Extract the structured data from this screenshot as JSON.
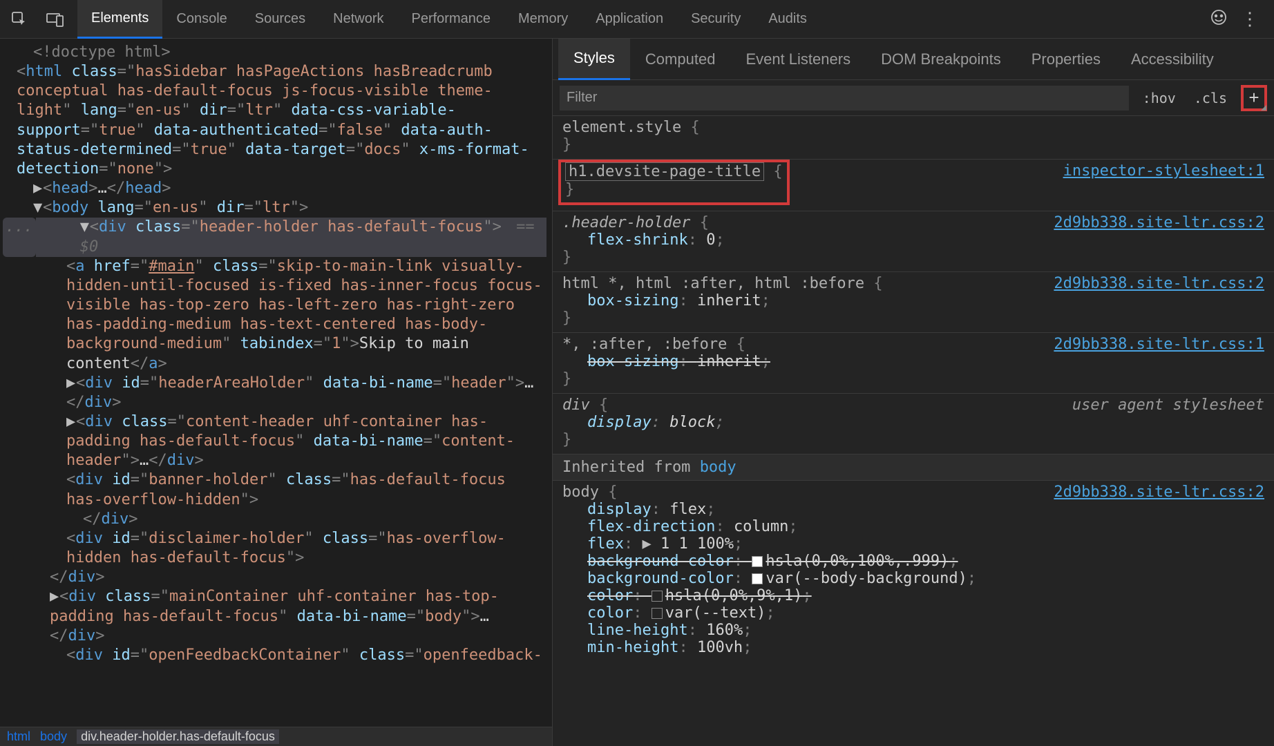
{
  "mainTabs": [
    "Elements",
    "Console",
    "Sources",
    "Network",
    "Performance",
    "Memory",
    "Application",
    "Security",
    "Audits"
  ],
  "mainActive": 0,
  "sidebarTabs": [
    "Styles",
    "Computed",
    "Event Listeners",
    "DOM Breakpoints",
    "Properties",
    "Accessibility"
  ],
  "sidebarActive": 0,
  "filter": {
    "placeholder": "Filter",
    "hov": ":hov",
    "cls": ".cls",
    "plus": "+"
  },
  "breadcrumbEllipsis": "...",
  "breadcrumb": [
    "html",
    "body",
    "div.header-holder.has-default-focus"
  ],
  "dom": {
    "doctype": "<!doctype html>",
    "htmlOpen": {
      "cls": "hasSidebar hasPageActions hasBreadcrumb conceptual has-default-focus js-focus-visible theme-light",
      "lang": "en-us",
      "dir": "ltr",
      "a1": "data-css-variable-support",
      "v1": "true",
      "a2": "data-authenticated",
      "v2": "false",
      "a3": "data-auth-status-determined",
      "v3": "true",
      "a4": "data-target",
      "v4": "docs",
      "a5": "x-ms-format-detection",
      "v5": "none"
    },
    "headCollapsed": "<head>…</head>",
    "bodyOpen": {
      "lang": "en-us",
      "dir": "ltr"
    },
    "headerHolder": {
      "cls": "header-holder has-default-focus",
      "eq": "== $0"
    },
    "skipLink": {
      "href": "#main",
      "cls": "skip-to-main-link visually-hidden-until-focused is-fixed has-inner-focus focus-visible has-top-zero has-left-zero has-right-zero has-padding-medium has-text-centered has-body-background-medium",
      "tabindex": "1",
      "text": "Skip to main content"
    },
    "headerArea": {
      "id": "headerAreaHolder",
      "bi": "header"
    },
    "contentHeader": {
      "cls": "content-header uhf-container has-padding has-default-focus",
      "bi": "content-header"
    },
    "bannerHolder": {
      "id": "banner-holder",
      "cls": "has-default-focus has-overflow-hidden"
    },
    "disclaimerHolder": {
      "id": "disclaimer-holder",
      "cls": "has-overflow-hidden has-default-focus"
    },
    "mainContainer": {
      "cls": "mainContainer  uhf-container has-top-padding  has-default-focus",
      "bi": "body"
    },
    "feedback": {
      "id": "openFeedbackContainer",
      "cls": "openfeedback-"
    }
  },
  "styles": {
    "r0": {
      "sel": "element.style"
    },
    "r1": {
      "sel": "h1.devsite-page-title",
      "src": "inspector-stylesheet:1"
    },
    "r2": {
      "sel": ".header-holder",
      "src": "2d9bb338.site-ltr.css:2",
      "p1n": "flex-shrink",
      "p1v": "0"
    },
    "r3": {
      "sel": "html *, html :after, html :before",
      "src": "2d9bb338.site-ltr.css:2",
      "p1n": "box-sizing",
      "p1v": "inherit"
    },
    "r4": {
      "sel": "*, :after, :before",
      "src": "2d9bb338.site-ltr.css:1",
      "p1n": "box-sizing",
      "p1v": "inherit"
    },
    "r5": {
      "sel": "div",
      "src": "user agent stylesheet",
      "p1n": "display",
      "p1v": "block"
    },
    "inheritedFrom": "Inherited from ",
    "inheritedBody": "body",
    "r6": {
      "sel": "body",
      "src": "2d9bb338.site-ltr.css:2",
      "p1n": "display",
      "p1v": "flex",
      "p2n": "flex-direction",
      "p2v": "column",
      "p3n": "flex",
      "p3v": "1 1 100%",
      "p4n": "background-color",
      "p4v": "hsla(0,0%,100%,.999)",
      "p5n": "background-color",
      "p5v": "var(--body-background)",
      "p6n": "color",
      "p6v": "hsla(0,0%,9%,1)",
      "p7n": "color",
      "p7v": "var(--text)",
      "p8n": "line-height",
      "p8v": "160%",
      "p9n": "min-height",
      "p9v": "100vh"
    }
  }
}
